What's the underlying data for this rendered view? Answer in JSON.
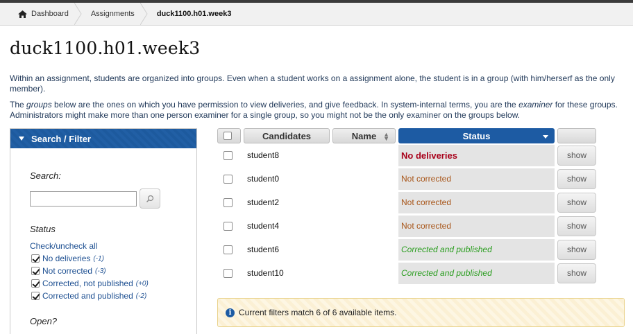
{
  "breadcrumb": {
    "items": [
      {
        "label": "Dashboard",
        "icon": "home-icon"
      },
      {
        "label": "Assignments"
      },
      {
        "label": "duck1100.h01.week3"
      }
    ]
  },
  "page": {
    "title": "duck1100.h01.week3",
    "intro_p1": "Within an assignment, students are organized into groups. Even when a student works on a assignment alone, the student is in a group (with him/herserf as the only member).",
    "intro_p2_a": "The ",
    "intro_p2_groups": "groups",
    "intro_p2_b": " below are the ones on which you have permission to view deliveries, and give feedback. In system-internal terms, you are the ",
    "intro_p2_examiner": "examiner",
    "intro_p2_c": " for these groups. Administrators might make more than one person examiner for a single group, so you might not be the only examiner on the groups below."
  },
  "sidebar": {
    "header": "Search / Filter",
    "search_label": "Search:",
    "search_value": "",
    "status_label": "Status",
    "check_all": "Check/uncheck all",
    "filters": [
      {
        "label": "No deliveries",
        "count": "(-1)",
        "checked": true
      },
      {
        "label": "Not corrected",
        "count": "(-3)",
        "checked": true
      },
      {
        "label": "Corrected, not published",
        "count": "(+0)",
        "checked": true
      },
      {
        "label": "Corrected and published",
        "count": "(-2)",
        "checked": true
      }
    ],
    "open_label": "Open?"
  },
  "table": {
    "headers": {
      "candidates": "Candidates",
      "name": "Name",
      "status": "Status"
    },
    "rows": [
      {
        "candidate": "student8",
        "name": "",
        "status": "No deliveries",
        "status_type": "none",
        "action": "show"
      },
      {
        "candidate": "student0",
        "name": "",
        "status": "Not corrected",
        "status_type": "notcorr",
        "action": "show"
      },
      {
        "candidate": "student2",
        "name": "",
        "status": "Not corrected",
        "status_type": "notcorr",
        "action": "show"
      },
      {
        "candidate": "student4",
        "name": "",
        "status": "Not corrected",
        "status_type": "notcorr",
        "action": "show"
      },
      {
        "candidate": "student6",
        "name": "",
        "status": "Corrected and published",
        "status_type": "pub",
        "action": "show"
      },
      {
        "candidate": "student10",
        "name": "",
        "status": "Corrected and published",
        "status_type": "pub",
        "action": "show"
      }
    ]
  },
  "info": {
    "text": "Current filters match 6 of 6 available items."
  },
  "colors": {
    "accent": "#1d5ba3",
    "no_deliveries": "#a8001a",
    "not_corrected": "#a8561a",
    "published": "#2a9d1f"
  }
}
